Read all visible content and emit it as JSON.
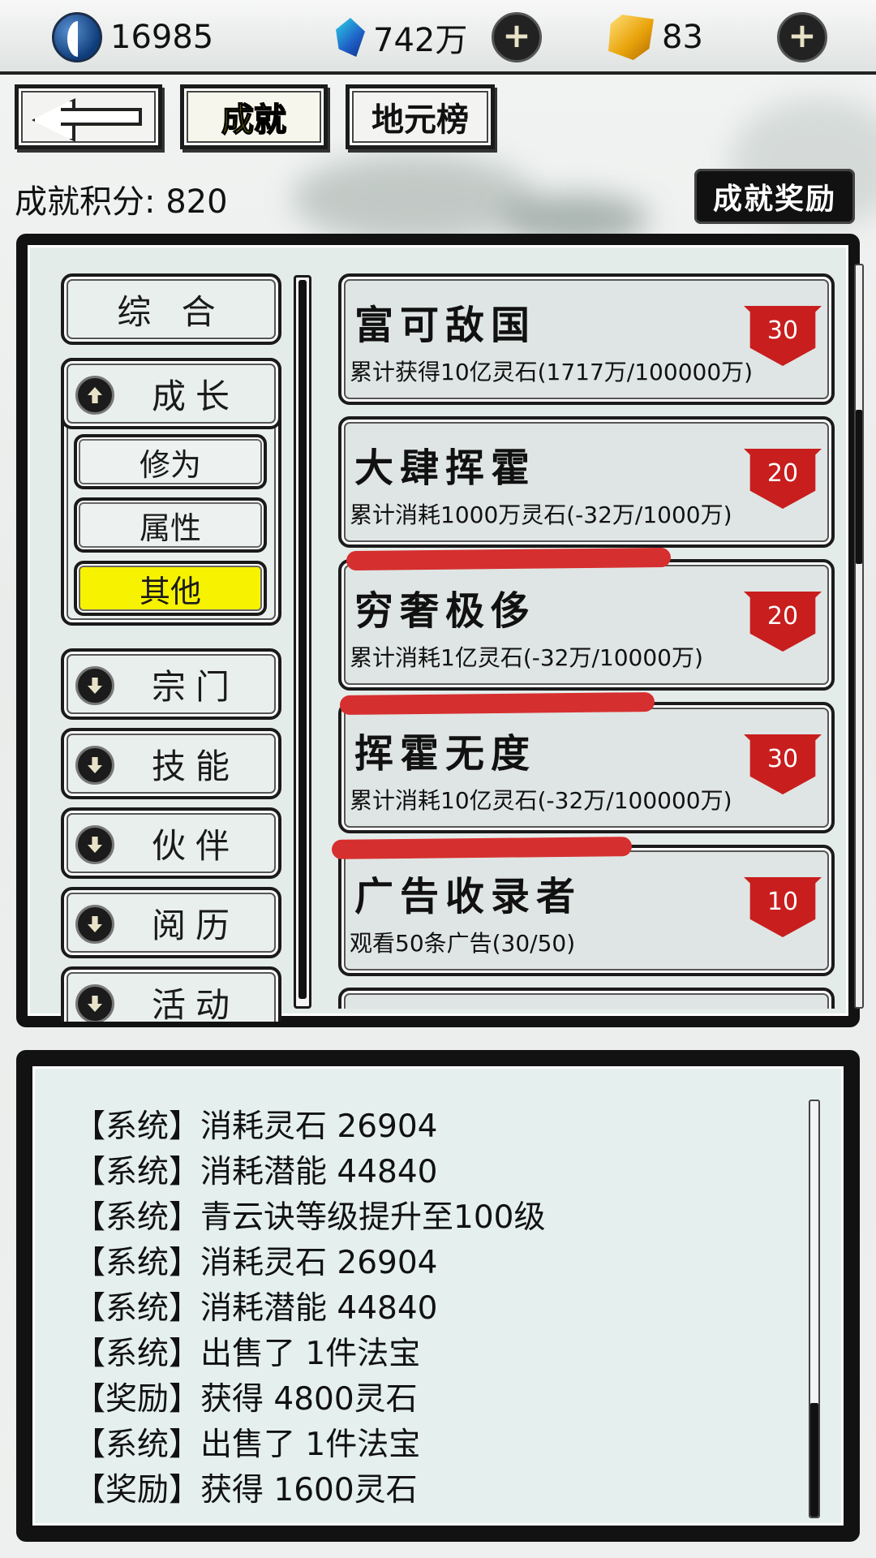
{
  "resources": {
    "spirit_points": "16985",
    "crystals": "742万",
    "gems": "83"
  },
  "nav": {
    "tab_achievement": "成就",
    "tab_ranking": "地元榜"
  },
  "score_label": "成就积分: 820",
  "reward_button": "成就奖励",
  "categories": {
    "general": "综 合",
    "growth": "成长",
    "growth_sub": [
      "修为",
      "属性",
      "其他"
    ],
    "sect": "宗门",
    "skill": "技能",
    "partner": "伙伴",
    "experience": "阅历",
    "activity": "活动"
  },
  "achievements": [
    {
      "title": "富可敌国",
      "desc": "累计获得10亿灵石(1717万/100000万)",
      "points": "30"
    },
    {
      "title": "大肆挥霍",
      "desc": "累计消耗1000万灵石(-32万/1000万)",
      "points": "20"
    },
    {
      "title": "穷奢极侈",
      "desc": "累计消耗1亿灵石(-32万/10000万)",
      "points": "20"
    },
    {
      "title": "挥霍无度",
      "desc": "累计消耗10亿灵石(-32万/100000万)",
      "points": "30"
    },
    {
      "title": "广告收录者",
      "desc": "观看50条广告(30/50)",
      "points": "10"
    }
  ],
  "log": [
    "【系统】消耗灵石 26904",
    "【系统】消耗潜能 44840",
    "【系统】青云诀等级提升至100级",
    "【系统】消耗灵石 26904",
    "【系统】消耗潜能 44840",
    "【系统】出售了 1件法宝",
    "【奖励】获得 4800灵石",
    "【系统】出售了 1件法宝",
    "【奖励】获得 1600灵石"
  ],
  "colors": {
    "active_tab_text": "#f2dd00",
    "active_category": "#f6f200",
    "banner_red": "#c81e1e",
    "markup_red": "#d62f2f"
  },
  "icons": [
    "yinyang-icon",
    "crystal-icon",
    "gem-icon",
    "plus-icon",
    "back-arrow-icon",
    "arrow-up-icon",
    "arrow-down-icon",
    "banner-icon"
  ]
}
